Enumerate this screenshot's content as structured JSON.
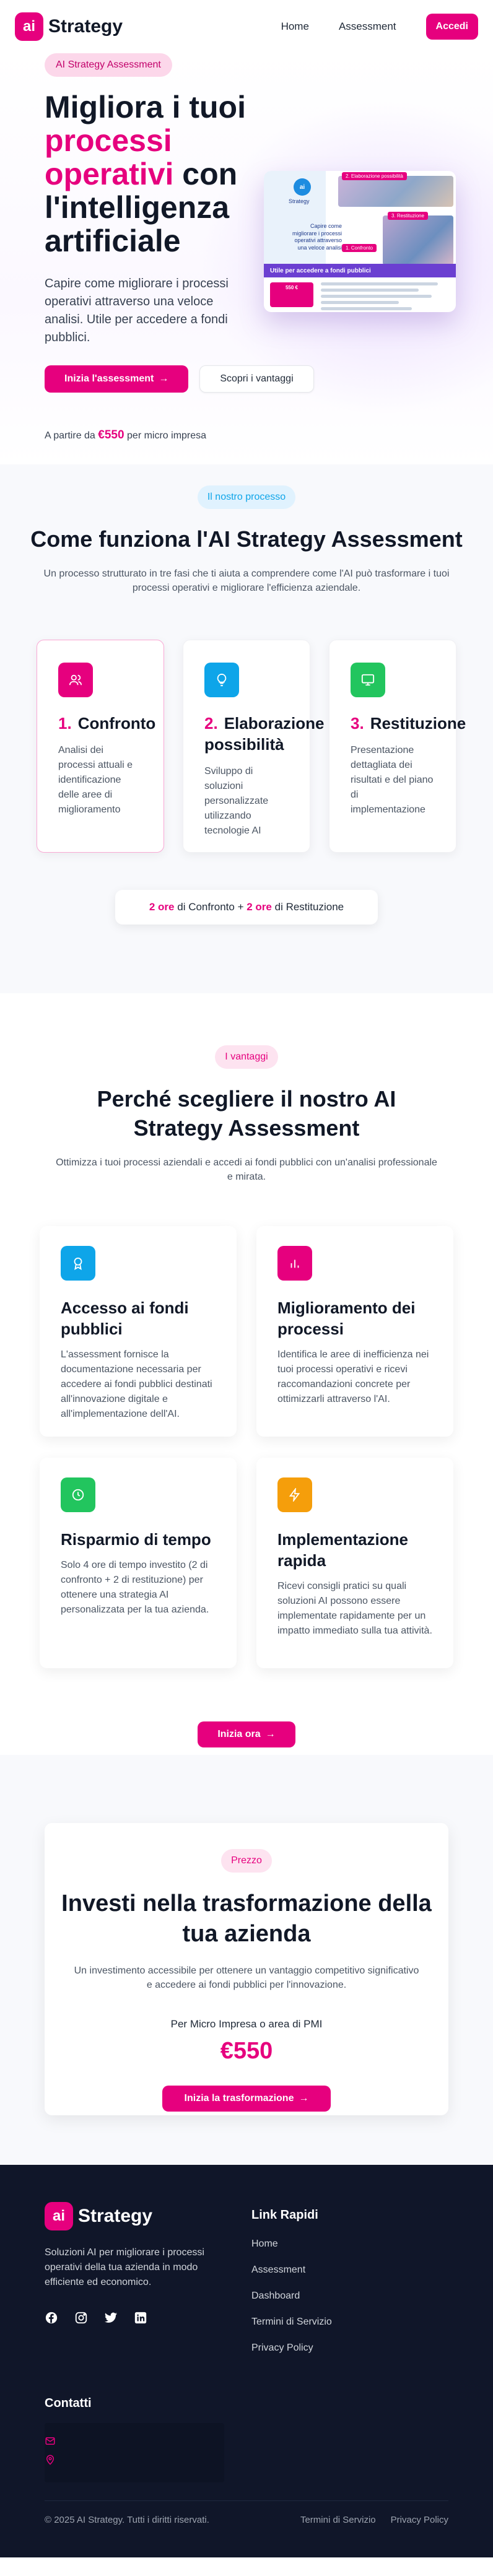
{
  "nav": {
    "logo_mark": "ai",
    "logo_text": "Strategy",
    "links": [
      "Home",
      "Assessment"
    ],
    "login_label": "Accedi"
  },
  "hero": {
    "badge": "AI Strategy Assessment",
    "title_part1": "Migliora i tuoi ",
    "title_highlight": "processi operativi",
    "title_part2": " con l'intelligenza artificiale",
    "text": "Capire come migliorare i processi operativi attraverso una veloce analisi. Utile per accedere a fondi pubblici.",
    "primary_button": "Inizia l'assessment",
    "secondary_button": "Scopri i vantaggi",
    "price_prefix": "A partire da",
    "price": "€550",
    "price_suffix": "per micro impresa",
    "image": {
      "badge": "ai",
      "brand": "Strategy",
      "tag1": "2. Elaborazione possibilità",
      "tag2": "1. Confronto",
      "tag3": "3. Restituzione",
      "title": "Capire come migliorare i processi operativi attraverso una veloce analisi",
      "bar": "Utile per accedere a fondi pubblici",
      "price": "550 €"
    }
  },
  "how": {
    "badge": "Il nostro processo",
    "title": "Come funziona l'AI Strategy Assessment",
    "subtitle": "Un processo strutturato in tre fasi che ti aiuta a comprendere come l'AI può trasformare i tuoi processi operativi e migliorare l'efficienza aziendale.",
    "steps": [
      {
        "num": "1.",
        "title": "Confronto",
        "text": "Analisi dei processi attuali e identificazione delle aree di miglioramento",
        "color": "#e6007e",
        "icon": "users-icon"
      },
      {
        "num": "2.",
        "title": "Elaborazione possibilità",
        "text": "Sviluppo di soluzioni personalizzate utilizzando tecnologie AI",
        "color": "#0ea5e9",
        "icon": "lightbulb-icon"
      },
      {
        "num": "3.",
        "title": "Restituzione",
        "text": "Presentazione dettagliata dei risultati e del piano di implementazione",
        "color": "#22c55e",
        "icon": "monitor-icon"
      }
    ],
    "hours": {
      "h1": "2 ore",
      "t1": "di Confronto +",
      "h2": "2 ore",
      "t2": "di Restituzione"
    }
  },
  "benefits": {
    "badge": "I vantaggi",
    "title": "Perché scegliere il nostro AI Strategy Assessment",
    "subtitle": "Ottimizza i tuoi processi aziendali e accedi ai fondi pubblici con un'analisi professionale e mirata.",
    "items": [
      {
        "title": "Accesso ai fondi pubblici",
        "text": "L'assessment fornisce la documentazione necessaria per accedere ai fondi pubblici destinati all'innovazione digitale e all'implementazione dell'AI.",
        "color": "#0ea5e9",
        "icon": "award-icon"
      },
      {
        "title": "Miglioramento dei processi",
        "text": "Identifica le aree di inefficienza nei tuoi processi operativi e ricevi raccomandazioni concrete per ottimizzarli attraverso l'AI.",
        "color": "#e6007e",
        "icon": "bar-chart-icon"
      },
      {
        "title": "Risparmio di tempo",
        "text": "Solo 4 ore di tempo investito (2 di confronto + 2 di restituzione) per ottenere una strategia AI personalizzata per la tua azienda.",
        "color": "#22c55e",
        "icon": "clock-icon"
      },
      {
        "title": "Implementazione rapida",
        "text": "Ricevi consigli pratici su quali soluzioni AI possono essere implementate rapidamente per un impatto immediato sulla tua attività.",
        "color": "#f59e0b",
        "icon": "zap-icon"
      }
    ],
    "cta": "Inizia ora"
  },
  "price": {
    "badge": "Prezzo",
    "title": "Investi nella trasformazione della tua azienda",
    "subtitle": "Un investimento accessibile per ottenere un vantaggio competitivo significativo e accedere ai fondi pubblici per l'innovazione.",
    "label": "Per Micro Impresa o area di PMI",
    "value": "€550",
    "cta": "Inizia la trasformazione"
  },
  "footer": {
    "description": "Soluzioni AI per migliorare i processi operativi della tua azienda in modo efficiente ed economico.",
    "quick_links_title": "Link Rapidi",
    "quick_links": [
      "Home",
      "Assessment",
      "Dashboard",
      "Termini di Servizio",
      "Privacy Policy"
    ],
    "contacts_title": "Contatti",
    "copyright": "© 2025 AI Strategy. Tutti i diritti riservati.",
    "bottom_links": [
      "Termini di Servizio",
      "Privacy Policy"
    ]
  }
}
